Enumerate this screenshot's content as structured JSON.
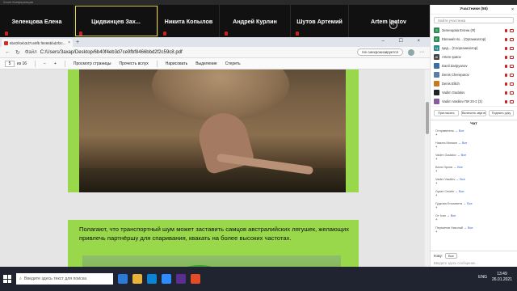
{
  "zoom": {
    "title": "Zoom Конференция"
  },
  "strip": {
    "tiles": [
      {
        "name": "Зеленцова Елена",
        "active": false
      },
      {
        "name": "Цидвинцев  Зах...",
        "active": true
      },
      {
        "name": "Никита Копылов",
        "active": false
      },
      {
        "name": "Андрей Курлин",
        "active": false
      },
      {
        "name": "Шутов Артемий",
        "active": false
      },
      {
        "name": "Artem Ipatov",
        "active": false
      }
    ],
    "next": "›"
  },
  "browser": {
    "tab_title": "6b40f4eb3d7ce9fb f8466bbd2f2c...",
    "tab_close": "×",
    "tab_add": "+",
    "window_controls": "–  ☐  ×",
    "nav_back": "←",
    "nav_refresh": "↻",
    "url_label": "Файл",
    "url": "C:/Users/Захар/Desktop/6b40f4eb3d7ce9fbf8466bbd2f2c59c8.pdf",
    "sync_label": "Не синхронизируется",
    "menu": "···"
  },
  "pdf_toolbar": {
    "page_current": "5",
    "page_total": "из 16",
    "zoom_minus": "−",
    "zoom_plus": "+",
    "page_view": "Просмотр страницы",
    "read_aloud": "Прочесть вслух",
    "draw": "Нарисовать",
    "highlight": "Выделение",
    "erase": "Стереть"
  },
  "pdf": {
    "paragraph": "Полагают, что транспортный шум может заставить самцов австралийских лягушек, желающих привлечь партнёршу для спаривания, квакать на более высоких частотах."
  },
  "participants": {
    "title": "Участники (55)",
    "search_placeholder": "Найти участника",
    "items": [
      {
        "initial": "З",
        "color": "#2e8b57",
        "name": "Зеленцова Елена (Я)"
      },
      {
        "initial": "Е",
        "color": "#2e8b57",
        "name": "Евгений Но... (Организатор)"
      },
      {
        "initial": "Ц",
        "color": "#2a8c8c",
        "name": "Цид... (Соорганизатор)"
      },
      {
        "initial": "AI",
        "color": "#444444",
        "name": "Artem Ipatov"
      },
      {
        "initial": "",
        "color": "#3a6ea5",
        "name": "Danil Zaripyanov"
      },
      {
        "initial": "",
        "color": "#5a7da8",
        "name": "Denis Chereparov"
      },
      {
        "initial": "",
        "color": "#c87a20",
        "name": "Denis Ellich"
      },
      {
        "initial": "",
        "color": "#222222",
        "name": "Vadim Gadalov"
      },
      {
        "initial": "",
        "color": "#8a5aa0",
        "name": "Vadim Vasiliev ПИ 20-2 (3)"
      }
    ],
    "buttons": [
      "Пригласить",
      "Включить звук всем",
      "Поднять руку"
    ]
  },
  "chat": {
    "title": "Чат",
    "messages": [
      {
        "from": "Отправитель",
        "to": "Все",
        "text": "+"
      },
      {
        "from": "Никита Милкин",
        "to": "Все",
        "text": "+"
      },
      {
        "from": "Vadim Gadalov",
        "to": "Все",
        "text": "+"
      },
      {
        "from": "Валя Орлов",
        "to": "Все",
        "text": "+"
      },
      {
        "from": "Vadim Vasiliev",
        "to": "Все",
        "text": "+"
      },
      {
        "from": "Лукин Семён",
        "to": "Все",
        "text": "+"
      },
      {
        "from": "Гудкова Елизавета",
        "to": "Все",
        "text": "+"
      },
      {
        "from": "От Ivan",
        "to": "Все",
        "text": "+"
      },
      {
        "from": "Перминов Николай",
        "to": "Все",
        "text": "+"
      }
    ],
    "to_label": "Кому:",
    "to_value": "Все",
    "input_placeholder": "Введите здесь сообщение..."
  },
  "taskbar": {
    "search_placeholder": "Введите здесь текст для поиска",
    "lang": "ENG",
    "time": "13:49",
    "date": "26.01.2021"
  }
}
